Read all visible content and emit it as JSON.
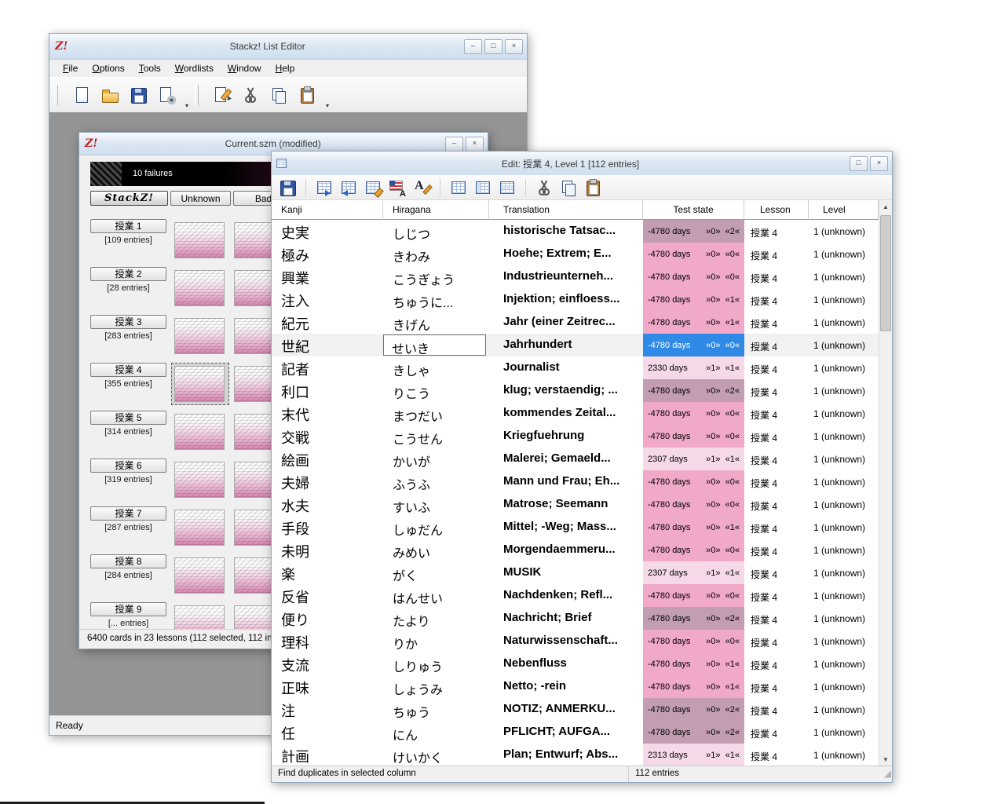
{
  "window_controls": {
    "minimize": "–",
    "maximize": "□",
    "close": "×"
  },
  "main_window": {
    "logo": "Z!",
    "title": "Stackz! List Editor",
    "menu": [
      {
        "label": "File"
      },
      {
        "label": "Options"
      },
      {
        "label": "Tools"
      },
      {
        "label": "Wordlists"
      },
      {
        "label": "Window"
      },
      {
        "label": "Help"
      }
    ],
    "toolbar": {
      "group1": [
        "new-document",
        "open-file",
        "save-file",
        "page-settings"
      ],
      "group2": [
        "edit-page",
        "cut",
        "copy",
        "paste"
      ]
    },
    "watermark": "Z!",
    "status": "Ready"
  },
  "stack_window": {
    "logo": "Z!",
    "title": "Current.szm (modified)",
    "failures_label": "10 failures",
    "stackz_button": "StackZ!",
    "unknown_button": "Unknown",
    "bad_button": "Bad",
    "lessons": [
      {
        "name": "授業 1",
        "count": "[109 entries]",
        "selected": false
      },
      {
        "name": "授業 2",
        "count": "[28 entries]",
        "selected": false
      },
      {
        "name": "授業 3",
        "count": "[283 entries]",
        "selected": false
      },
      {
        "name": "授業 4",
        "count": "[355 entries]",
        "selected": true
      },
      {
        "name": "授業 5",
        "count": "[314 entries]",
        "selected": false
      },
      {
        "name": "授業 6",
        "count": "[319 entries]",
        "selected": false
      },
      {
        "name": "授業 7",
        "count": "[287 entries]",
        "selected": false
      },
      {
        "name": "授業 8",
        "count": "[284 entries]",
        "selected": false
      },
      {
        "name": "授業 9",
        "count": "[... entries]",
        "selected": false
      }
    ],
    "status": "6400 cards in 23 lessons (112 selected, 112 in"
  },
  "edit_window": {
    "title": "Edit: 授業 4, Level 1 [112 entries]",
    "toolbar_groups": [
      [
        "save-file"
      ],
      [
        "table-import",
        "table-export",
        "table-properties",
        "sort-language-flag",
        "font-edit"
      ],
      [
        "table-view-1",
        "table-view-2",
        "table-view-3"
      ],
      [
        "cut",
        "copy",
        "paste"
      ]
    ],
    "columns": [
      "Kanji",
      "Hiragana",
      "Translation",
      "Test state",
      "Lesson",
      "Level"
    ],
    "colors": {
      "overdue": "#f0a9c8",
      "overdue2": "#c39eb3",
      "recent": "#f6d9e8",
      "selected": "#2e8ae6"
    },
    "rows": [
      {
        "kanji": "史実",
        "hiragana": "しじつ",
        "translation": "historische Tatsac...",
        "test_days": "-4780 days",
        "test_marks": "»0»  «2«",
        "lesson": "授業 4",
        "level": "1 (unknown)",
        "state": "overdue2"
      },
      {
        "kanji": "極み",
        "hiragana": "きわみ",
        "translation": "Hoehe; Extrem; E...",
        "test_days": "-4780 days",
        "test_marks": "»0»  «0«",
        "lesson": "授業 4",
        "level": "1 (unknown)",
        "state": "overdue"
      },
      {
        "kanji": "興業",
        "hiragana": "こうぎょう",
        "translation": "Industrieunterneh...",
        "test_days": "-4780 days",
        "test_marks": "»0»  «0«",
        "lesson": "授業 4",
        "level": "1 (unknown)",
        "state": "overdue"
      },
      {
        "kanji": "注入",
        "hiragana": "ちゅうに...",
        "translation": "Injektion; einfloess...",
        "test_days": "-4780 days",
        "test_marks": "»0»  «1«",
        "lesson": "授業 4",
        "level": "1 (unknown)",
        "state": "overdue"
      },
      {
        "kanji": "紀元",
        "hiragana": "きげん",
        "translation": "Jahr (einer Zeitrec...",
        "test_days": "-4780 days",
        "test_marks": "»0»  «1«",
        "lesson": "授業 4",
        "level": "1 (unknown)",
        "state": "overdue"
      },
      {
        "kanji": "世紀",
        "hiragana": "せいき",
        "translation": "Jahrhundert",
        "test_days": "-4780 days",
        "test_marks": "»0»  «0«",
        "lesson": "授業 4",
        "level": "1 (unknown)",
        "state": "selected"
      },
      {
        "kanji": "記者",
        "hiragana": "きしゃ",
        "translation": "Journalist",
        "test_days": "2330 days",
        "test_marks": "»1»  «1«",
        "lesson": "授業 4",
        "level": "1 (unknown)",
        "state": "recent"
      },
      {
        "kanji": "利口",
        "hiragana": "りこう",
        "translation": "klug; verstaendig; ...",
        "test_days": "-4780 days",
        "test_marks": "»0»  «2«",
        "lesson": "授業 4",
        "level": "1 (unknown)",
        "state": "overdue2"
      },
      {
        "kanji": "末代",
        "hiragana": "まつだい",
        "translation": "kommendes Zeital...",
        "test_days": "-4780 days",
        "test_marks": "»0»  «0«",
        "lesson": "授業 4",
        "level": "1 (unknown)",
        "state": "overdue"
      },
      {
        "kanji": "交戦",
        "hiragana": "こうせん",
        "translation": "Kriegfuehrung",
        "test_days": "-4780 days",
        "test_marks": "»0»  «0«",
        "lesson": "授業 4",
        "level": "1 (unknown)",
        "state": "overdue"
      },
      {
        "kanji": "絵画",
        "hiragana": "かいが",
        "translation": "Malerei; Gemaeld...",
        "test_days": "2307 days",
        "test_marks": "»1»  «1«",
        "lesson": "授業 4",
        "level": "1 (unknown)",
        "state": "recent"
      },
      {
        "kanji": "夫婦",
        "hiragana": "ふうふ",
        "translation": "Mann und Frau; Eh...",
        "test_days": "-4780 days",
        "test_marks": "»0»  «0«",
        "lesson": "授業 4",
        "level": "1 (unknown)",
        "state": "overdue"
      },
      {
        "kanji": "水夫",
        "hiragana": "すいふ",
        "translation": "Matrose; Seemann",
        "test_days": "-4780 days",
        "test_marks": "»0»  «0«",
        "lesson": "授業 4",
        "level": "1 (unknown)",
        "state": "overdue"
      },
      {
        "kanji": "手段",
        "hiragana": "しゅだん",
        "translation": "Mittel; -Weg; Mass...",
        "test_days": "-4780 days",
        "test_marks": "»0»  «1«",
        "lesson": "授業 4",
        "level": "1 (unknown)",
        "state": "overdue"
      },
      {
        "kanji": "未明",
        "hiragana": "みめい",
        "translation": "Morgendaemmeru...",
        "test_days": "-4780 days",
        "test_marks": "»0»  «0«",
        "lesson": "授業 4",
        "level": "1 (unknown)",
        "state": "overdue"
      },
      {
        "kanji": "楽",
        "hiragana": "がく",
        "translation": "MUSIK",
        "test_days": "2307 days",
        "test_marks": "»1»  «1«",
        "lesson": "授業 4",
        "level": "1 (unknown)",
        "state": "recent"
      },
      {
        "kanji": "反省",
        "hiragana": "はんせい",
        "translation": "Nachdenken; Refl...",
        "test_days": "-4780 days",
        "test_marks": "»0»  «0«",
        "lesson": "授業 4",
        "level": "1 (unknown)",
        "state": "overdue"
      },
      {
        "kanji": "便り",
        "hiragana": "たより",
        "translation": "Nachricht; Brief",
        "test_days": "-4780 days",
        "test_marks": "»0»  «2«",
        "lesson": "授業 4",
        "level": "1 (unknown)",
        "state": "overdue2"
      },
      {
        "kanji": "理科",
        "hiragana": "りか",
        "translation": "Naturwissenschaft...",
        "test_days": "-4780 days",
        "test_marks": "»0»  «0«",
        "lesson": "授業 4",
        "level": "1 (unknown)",
        "state": "overdue"
      },
      {
        "kanji": "支流",
        "hiragana": "しりゅう",
        "translation": "Nebenfluss",
        "test_days": "-4780 days",
        "test_marks": "»0»  «1«",
        "lesson": "授業 4",
        "level": "1 (unknown)",
        "state": "overdue"
      },
      {
        "kanji": "正味",
        "hiragana": "しょうみ",
        "translation": "Netto; -rein",
        "test_days": "-4780 days",
        "test_marks": "»0»  «1«",
        "lesson": "授業 4",
        "level": "1 (unknown)",
        "state": "overdue"
      },
      {
        "kanji": "注",
        "hiragana": "ちゅう",
        "translation": "NOTIZ; ANMERKU...",
        "test_days": "-4780 days",
        "test_marks": "»0»  «2«",
        "lesson": "授業 4",
        "level": "1 (unknown)",
        "state": "overdue2"
      },
      {
        "kanji": "任",
        "hiragana": "にん",
        "translation": "PFLICHT; AUFGA...",
        "test_days": "-4780 days",
        "test_marks": "»0»  «2«",
        "lesson": "授業 4",
        "level": "1 (unknown)",
        "state": "overdue2"
      },
      {
        "kanji": "計画",
        "hiragana": "けいかく",
        "translation": "Plan; Entwurf; Abs...",
        "test_days": "2313 days",
        "test_marks": "»1»  «1«",
        "lesson": "授業 4",
        "level": "1 (unknown)",
        "state": "recent"
      }
    ],
    "scrollbar": {
      "up": "▲",
      "down": "▼"
    },
    "status_left": "Find duplicates in selected column",
    "status_right": "112 entries",
    "grip": "◢"
  }
}
